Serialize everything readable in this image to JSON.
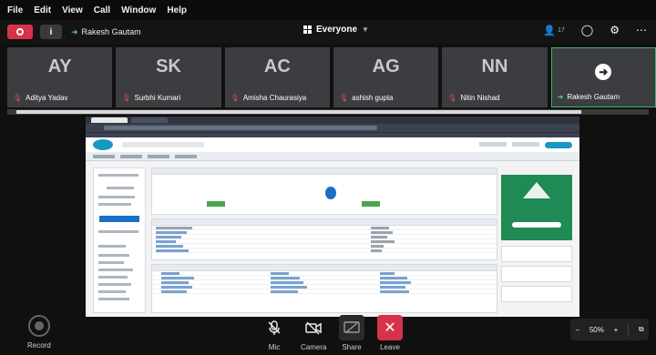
{
  "menu": [
    "File",
    "Edit",
    "View",
    "Call",
    "Window",
    "Help"
  ],
  "header": {
    "presenter_name": "Rakesh Gautam",
    "audience": "Everyone",
    "participant_count": "17"
  },
  "participants": [
    {
      "initials": "AY",
      "name": "Aditya Yadav"
    },
    {
      "initials": "SK",
      "name": "Surbhi Kumari"
    },
    {
      "initials": "AC",
      "name": "Amisha Chaurasiya"
    },
    {
      "initials": "AG",
      "name": "ashish gupta"
    },
    {
      "initials": "NN",
      "name": "Nitin Nishad"
    }
  ],
  "active_participant": {
    "name": "Rakesh Gautam"
  },
  "controls": {
    "record": "Record",
    "mic": "Mic",
    "camera": "Camera",
    "share": "Share",
    "leave": "Leave",
    "zoom_value": "50%"
  },
  "colors": {
    "leave": "#d6334b",
    "presenter_accent": "#5bd16b",
    "mic_off": "#e0485a"
  }
}
